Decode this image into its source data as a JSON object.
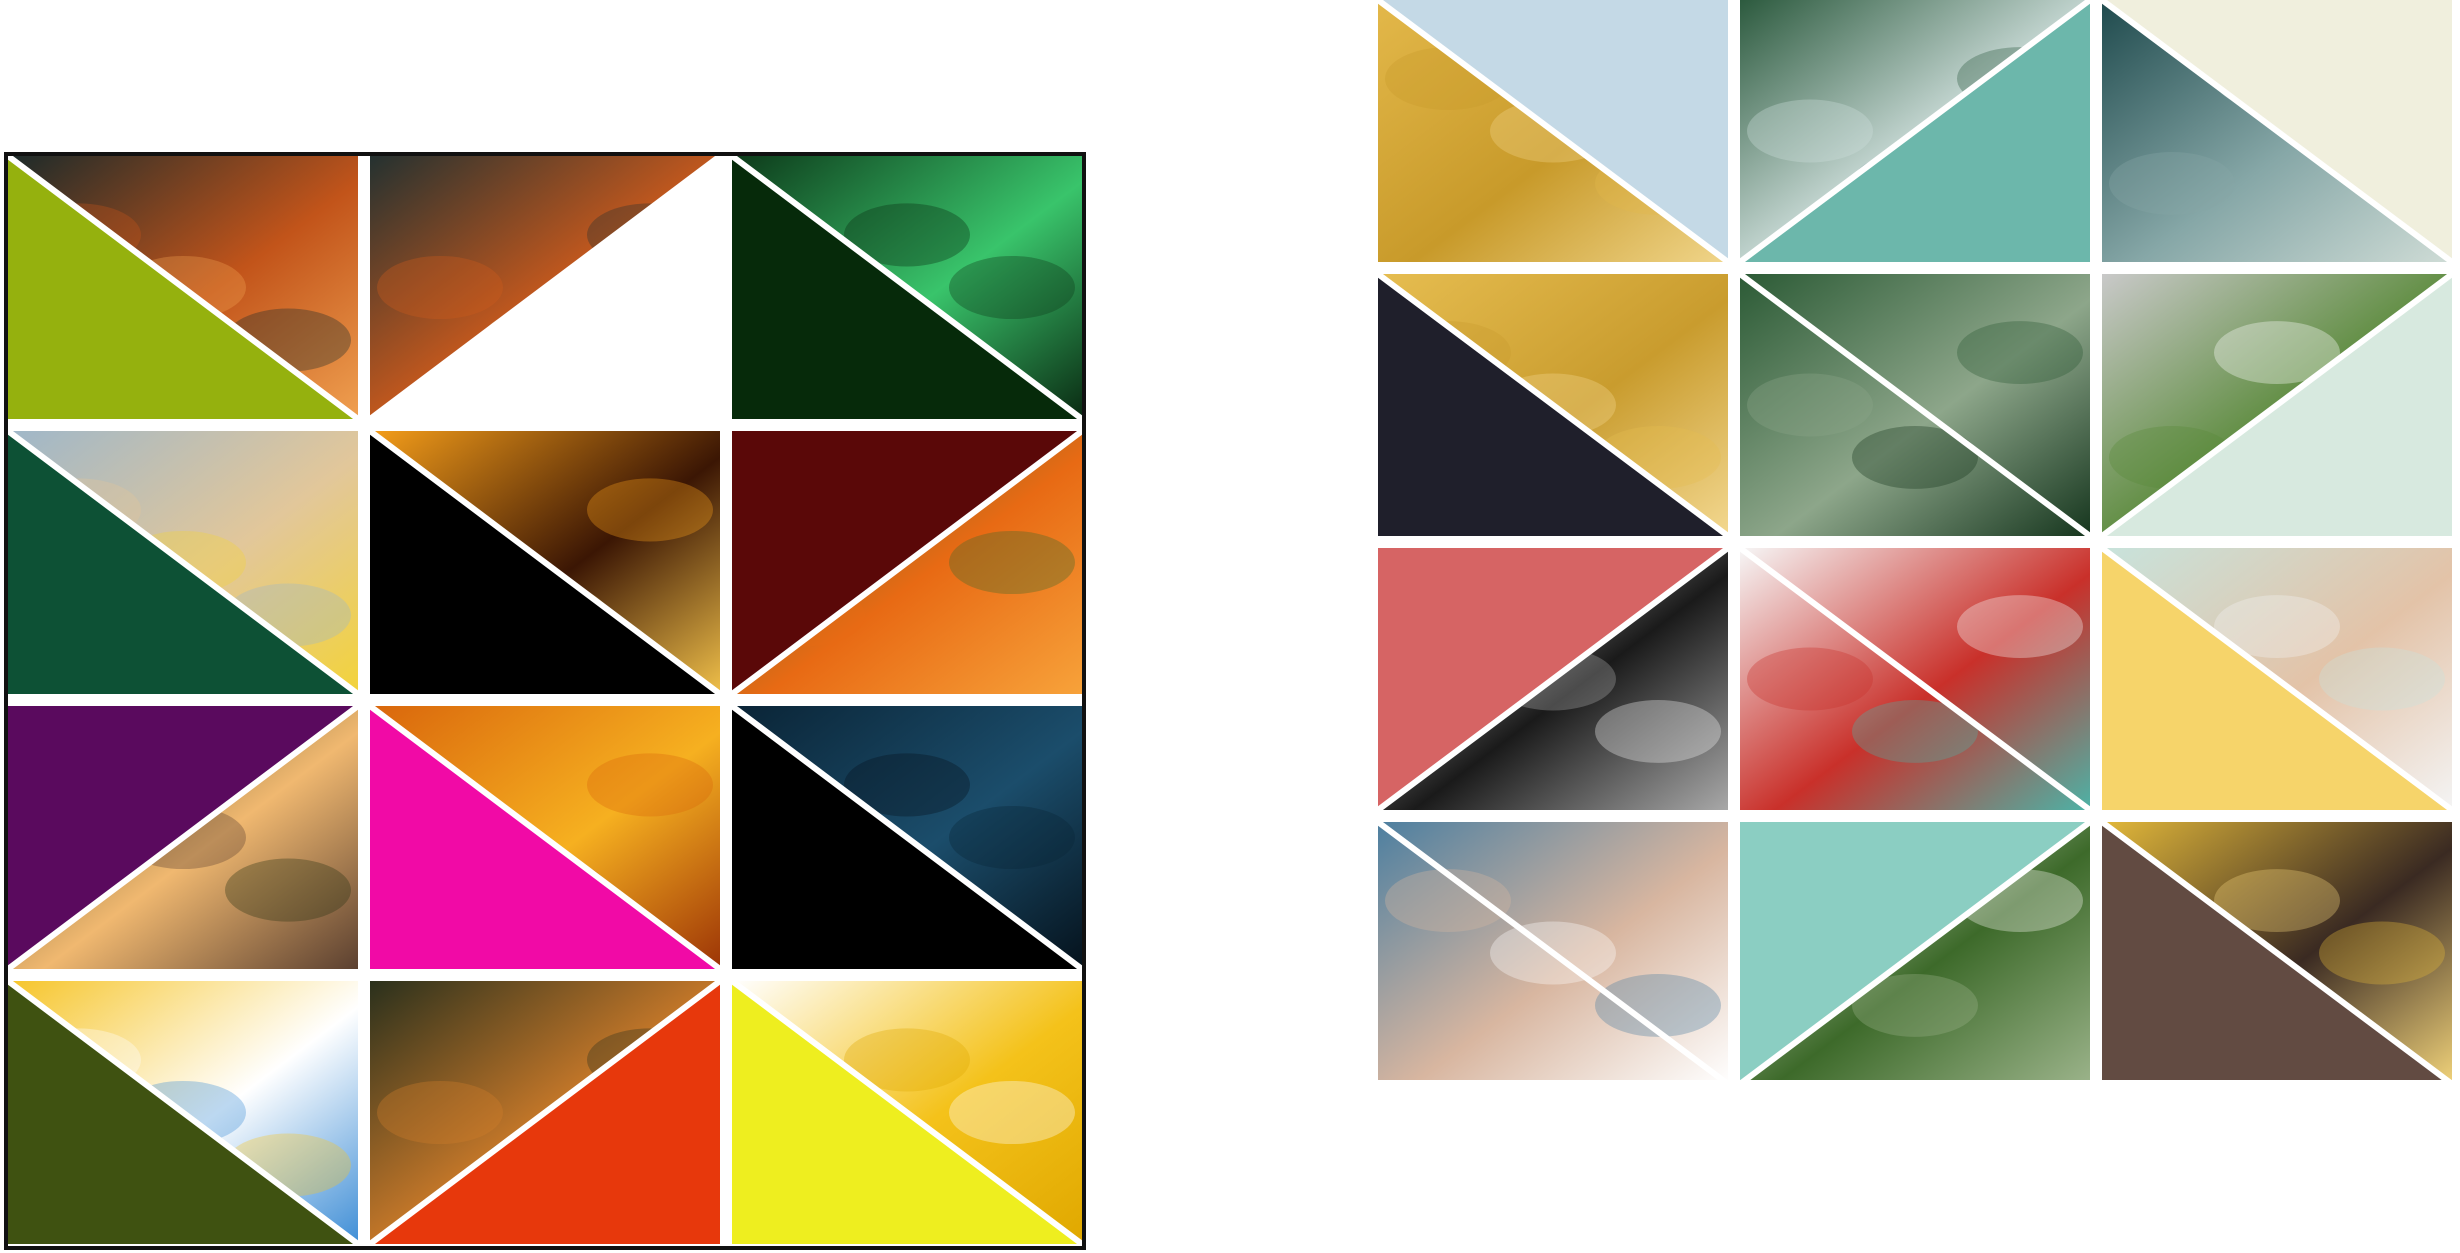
{
  "left_collage": {
    "tiles": [
      {
        "photo": "night-forest-autumn",
        "triangle": "lower-left",
        "color": "#95b10e",
        "photo_colors": [
          "#1b2a2a",
          "#c2541a",
          "#f0a050"
        ]
      },
      {
        "photo": "full-moon-lake",
        "triangle": "lower-right",
        "color": "#ffffff",
        "photo_colors": [
          "#243130",
          "#cf5b1c",
          "#e8d9a0"
        ]
      },
      {
        "photo": "green-wave",
        "triangle": "lower-left",
        "color": "#062a0a",
        "photo_colors": [
          "#0d3a1a",
          "#39c46b",
          "#0a2a12"
        ]
      },
      {
        "photo": "smiley-on-beach",
        "triangle": "lower-left",
        "color": "#0d5135",
        "photo_colors": [
          "#9fb7c9",
          "#e2c79a",
          "#f3d33a"
        ]
      },
      {
        "photo": "palm-sunset",
        "triangle": "lower-left",
        "color": "#000000",
        "photo_colors": [
          "#f59e1a",
          "#3b1604",
          "#f0c04a"
        ]
      },
      {
        "photo": "orange-poppies",
        "triangle": "upper-left",
        "color": "#5a0808",
        "photo_colors": [
          "#3e6b2a",
          "#e86a14",
          "#f7a23a"
        ]
      },
      {
        "photo": "forest-path-sunlight",
        "triangle": "upper-left",
        "color": "#5a0a5e",
        "photo_colors": [
          "#2c3315",
          "#f0b870",
          "#5b4030"
        ]
      },
      {
        "photo": "smiley-balls-closeup",
        "triangle": "lower-left",
        "color": "#f10aa6",
        "photo_colors": [
          "#d9660c",
          "#f6b020",
          "#9c3406"
        ]
      },
      {
        "photo": "moon-night-sky",
        "triangle": "lower-left",
        "color": "#000000",
        "photo_colors": [
          "#0a2436",
          "#1b4d6b",
          "#05121c"
        ]
      },
      {
        "photo": "cartoon-smiley",
        "triangle": "lower-left",
        "color": "#3f5211",
        "photo_colors": [
          "#f6c52a",
          "#ffffff",
          "#3f8ed6"
        ]
      },
      {
        "photo": "forest-path-dusk",
        "triangle": "lower-right",
        "color": "#e7380c",
        "photo_colors": [
          "#2a301c",
          "#d17d2a",
          "#4c5a2a"
        ]
      },
      {
        "photo": "emoji-balloons",
        "triangle": "lower-left",
        "color": "#eeee1f",
        "photo_colors": [
          "#ffffff",
          "#f4c21a",
          "#e0a800"
        ]
      }
    ]
  },
  "right_collage": {
    "tiles": [
      {
        "photo": "woman-in-yellow-flowers",
        "triangle": "upper-right",
        "color": "#c4d9e6",
        "photo_colors": [
          "#e3b84a",
          "#c89a2a",
          "#f0d58a"
        ]
      },
      {
        "photo": "snowy-mountains-pines",
        "triangle": "lower-right",
        "color": "#6cb7ab",
        "photo_colors": [
          "#2c5a3e",
          "#cfdfdc",
          "#5b8a89"
        ]
      },
      {
        "photo": "mountain-ridge",
        "triangle": "upper-right",
        "color": "#f0efdd",
        "photo_colors": [
          "#1f4a4d",
          "#86a7a7",
          "#cfdcd6"
        ]
      },
      {
        "photo": "woman-in-yellow-flowers-2",
        "triangle": "lower-left",
        "color": "#1f1f2b",
        "photo_colors": [
          "#e6bd50",
          "#c99c2e",
          "#f3d890"
        ]
      },
      {
        "photo": "pine-forest-cliffs",
        "triangle": "none",
        "color": "#2a5a3a",
        "photo_colors": [
          "#2b5a35",
          "#8da68a",
          "#16361e"
        ]
      },
      {
        "photo": "box-outline-print",
        "triangle": "lower-right",
        "color": "#d7e9df",
        "photo_colors": [
          "#c9c9c9",
          "#5a8a3a",
          "#ffffff"
        ]
      },
      {
        "photo": "pans-and-sieve",
        "triangle": "upper-left",
        "color": "#d66464",
        "photo_colors": [
          "#f2f2f2",
          "#1a1a1a",
          "#a8a8a8"
        ]
      },
      {
        "photo": "kitchen-clock-rail",
        "triangle": "none",
        "color": "#5fb8ac",
        "photo_colors": [
          "#f6f6f6",
          "#c9302a",
          "#4db2a6"
        ]
      },
      {
        "photo": "woman-mint-sweater",
        "triangle": "lower-left",
        "color": "#f6d46a",
        "photo_colors": [
          "#c8e3dc",
          "#e3c3a8",
          "#f4f4f4"
        ]
      },
      {
        "photo": "man-with-script-overlay",
        "triangle": "none",
        "color": "#6c9cb8",
        "photo_colors": [
          "#4d7fa0",
          "#d8b6a0",
          "#ffffff"
        ]
      },
      {
        "photo": "potted-plant",
        "triangle": "upper-left",
        "color": "#8bcec2",
        "photo_colors": [
          "#f7f7f2",
          "#3d6a2a",
          "#9bb38a"
        ]
      },
      {
        "photo": "yellow-knit-and-bag",
        "triangle": "lower-left",
        "color": "#624b42",
        "photo_colors": [
          "#e2b83a",
          "#3a2a22",
          "#f0d27a"
        ]
      }
    ]
  }
}
